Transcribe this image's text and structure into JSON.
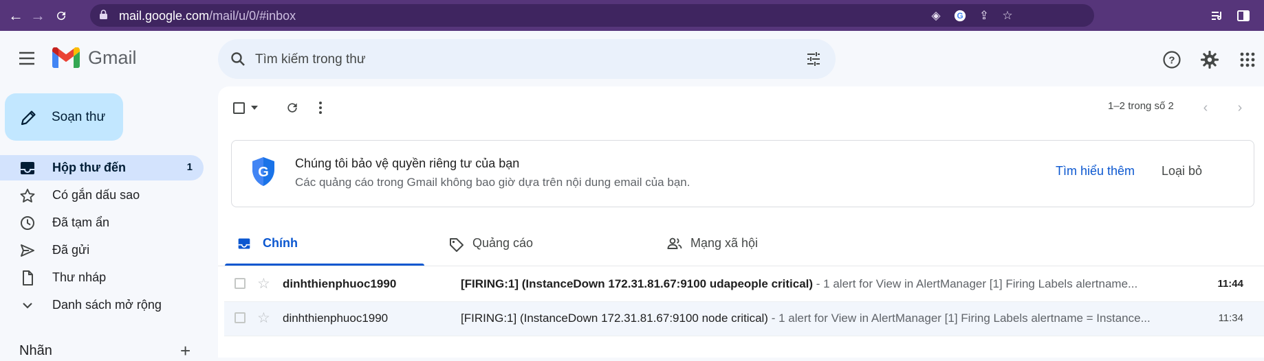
{
  "browser": {
    "url_host": "mail.google.com",
    "url_path": "/mail/u/0/#inbox"
  },
  "header": {
    "logo_text": "Gmail",
    "search_placeholder": "Tìm kiếm trong thư"
  },
  "sidebar": {
    "compose_label": "Soạn thư",
    "items": [
      {
        "label": "Hộp thư đến",
        "count": "1",
        "icon": "inbox-icon",
        "active": true
      },
      {
        "label": "Có gắn dấu sao",
        "icon": "star-icon"
      },
      {
        "label": "Đã tạm ẩn",
        "icon": "clock-icon"
      },
      {
        "label": "Đã gửi",
        "icon": "send-icon"
      },
      {
        "label": "Thư nháp",
        "icon": "draft-icon"
      },
      {
        "label": "Danh sách mở rộng",
        "icon": "chevron-down-icon"
      }
    ],
    "labels_heading": "Nhãn"
  },
  "toolbar": {
    "pager": "1–2 trong số 2"
  },
  "banner": {
    "title": "Chúng tôi bảo vệ quyền riêng tư của bạn",
    "subtitle": "Các quảng cáo trong Gmail không bao giờ dựa trên nội dung email của bạn.",
    "learn_more": "Tìm hiểu thêm",
    "dismiss": "Loại bỏ"
  },
  "tabs": [
    {
      "label": "Chính",
      "icon": "inbox-icon",
      "active": true
    },
    {
      "label": "Quảng cáo",
      "icon": "tag-icon"
    },
    {
      "label": "Mạng xã hội",
      "icon": "people-icon"
    }
  ],
  "emails": [
    {
      "from": "dinhthienphuoc1990",
      "subject": "[FIRING:1] (InstanceDown 172.31.81.67:9100 udapeople critical)",
      "snippet": " - 1 alert for View in AlertManager [1] Firing Labels alertname...",
      "time": "11:44",
      "unread": true
    },
    {
      "from": "dinhthienphuoc1990",
      "subject": "[FIRING:1] (InstanceDown 172.31.81.67:9100 node critical)",
      "snippet": " - 1 alert for View in AlertManager [1] Firing Labels alertname = Instance...",
      "time": "11:34",
      "unread": false
    }
  ],
  "colors": {
    "browser_frame": "#56357a",
    "compose_bg": "#c2e7ff",
    "active_nav_bg": "#d3e3fd",
    "accent_blue": "#0b57d0"
  }
}
